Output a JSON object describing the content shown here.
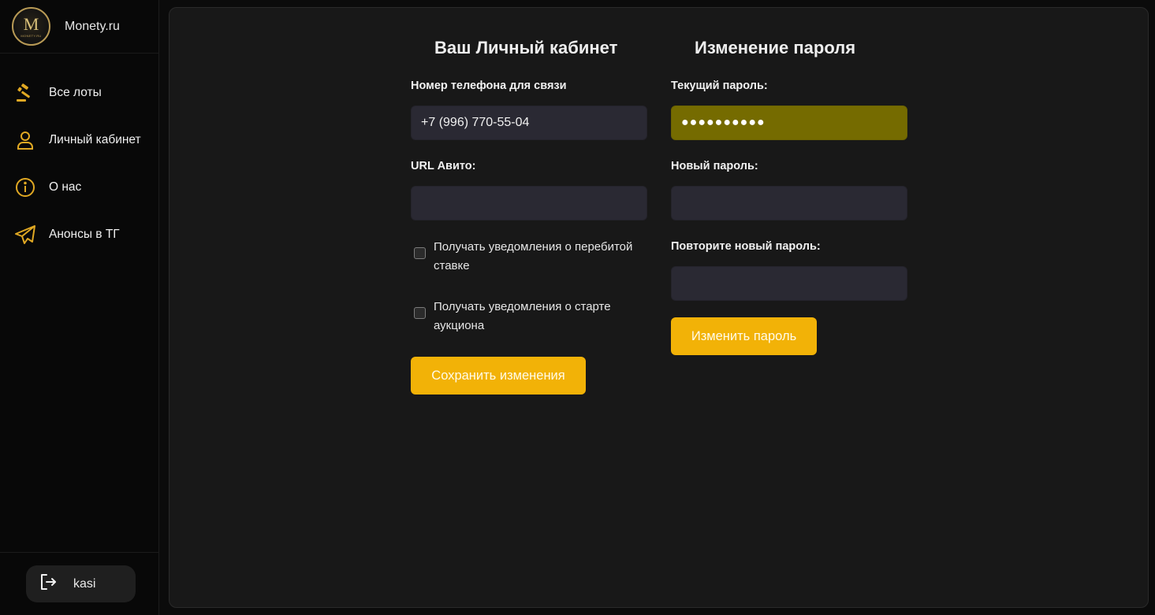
{
  "brand": {
    "name": "Monety.ru",
    "logo_letter": "M",
    "logo_caption": "MONETY.RU"
  },
  "nav": {
    "items": [
      {
        "label": "Все лоты",
        "icon": "gavel-icon"
      },
      {
        "label": "Личный кабинет",
        "icon": "user-icon"
      },
      {
        "label": "О нас",
        "icon": "info-icon"
      },
      {
        "label": "Анонсы в ТГ",
        "icon": "telegram-icon"
      }
    ]
  },
  "user": {
    "name": "kasi",
    "icon": "logout-icon"
  },
  "profile": {
    "title": "Ваш Личный кабинет",
    "phone_label": "Номер телефона для связи",
    "phone_value": "+7 (996) 770-55-04",
    "avito_label": "URL Авито:",
    "avito_value": "",
    "notify_outbid": "Получать уведомления о перебитой ставке",
    "notify_auction_start": "Получать уведомления о старте аукциона",
    "save_button": "Сохранить изменения"
  },
  "password": {
    "title": "Изменение пароля",
    "current_label": "Текущий пароль:",
    "current_value": "●●●●●●●●●●",
    "new_label": "Новый пароль:",
    "repeat_label": "Повторите новый пароль:",
    "change_button": "Изменить пароль"
  },
  "colors": {
    "accent": "#f2b207",
    "icon_gold": "#e0a823",
    "autofill": "#756b00",
    "input_bg": "#2a2933"
  }
}
